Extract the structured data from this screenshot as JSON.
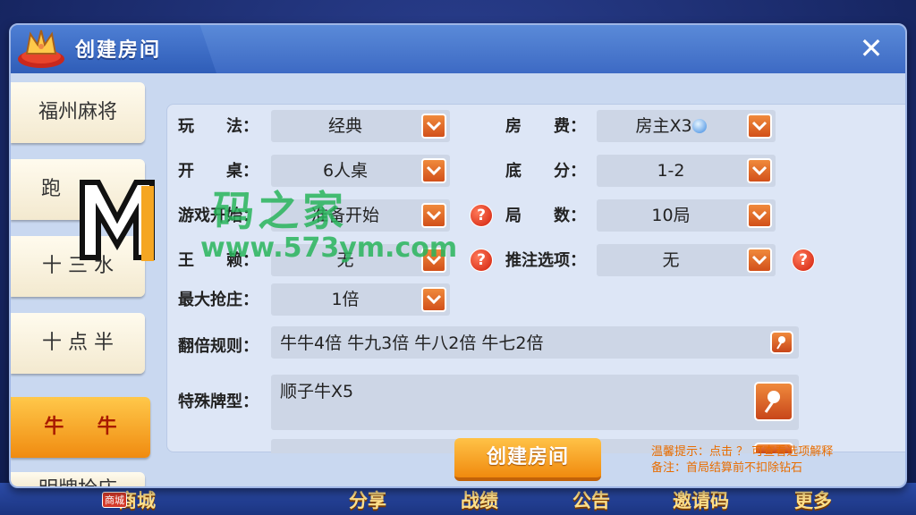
{
  "bg_nav": {
    "items": [
      "商城",
      "分享",
      "战绩",
      "公告",
      "邀请码",
      "更多"
    ],
    "shop_badge": "商城"
  },
  "modal": {
    "title": "创建房间",
    "close_symbol": "✕"
  },
  "sidebar": {
    "items": [
      {
        "label": "福州麻将"
      },
      {
        "label": "跑"
      },
      {
        "label": "十 三 水"
      },
      {
        "label": "十 点 半"
      },
      {
        "label": "牛 　 牛"
      },
      {
        "label": "明牌抢庄"
      }
    ]
  },
  "form": {
    "play_label": "玩　　法：",
    "play_value": "经典",
    "fee_label": "房　　费：",
    "fee_value": "房主X3",
    "table_label": "开　　桌：",
    "table_value": "6人桌",
    "score_label": "底　　分：",
    "score_value": "1-2",
    "start_label": "游戏开始：",
    "start_value": "准备开始",
    "rounds_label": "局　　数：",
    "rounds_value": "10局",
    "wang_label": "王　　赖：",
    "wang_value": "无",
    "bet_label": "推注选项：",
    "bet_value": "无",
    "banker_label": "最大抢庄：",
    "banker_value": "1倍",
    "multiplier_label": "翻倍规则：",
    "multiplier_value": "牛牛4倍 牛九3倍 牛八2倍 牛七2倍",
    "special_label": "特殊牌型：",
    "special_value": "顺子牛X5",
    "help_symbol": "?"
  },
  "footer": {
    "create_label": "创建房间",
    "tip_line1": "温馨提示：点击 ？ 可查看选项解释",
    "tip_line2": "备注：首局结算前不扣除钻石"
  },
  "watermark": {
    "text": "码之家",
    "url": "www.573ym.com"
  },
  "colors": {
    "accent_orange": "#f08a0e",
    "header_blue": "#3d6ac4",
    "tip_orange": "#e86d00"
  }
}
